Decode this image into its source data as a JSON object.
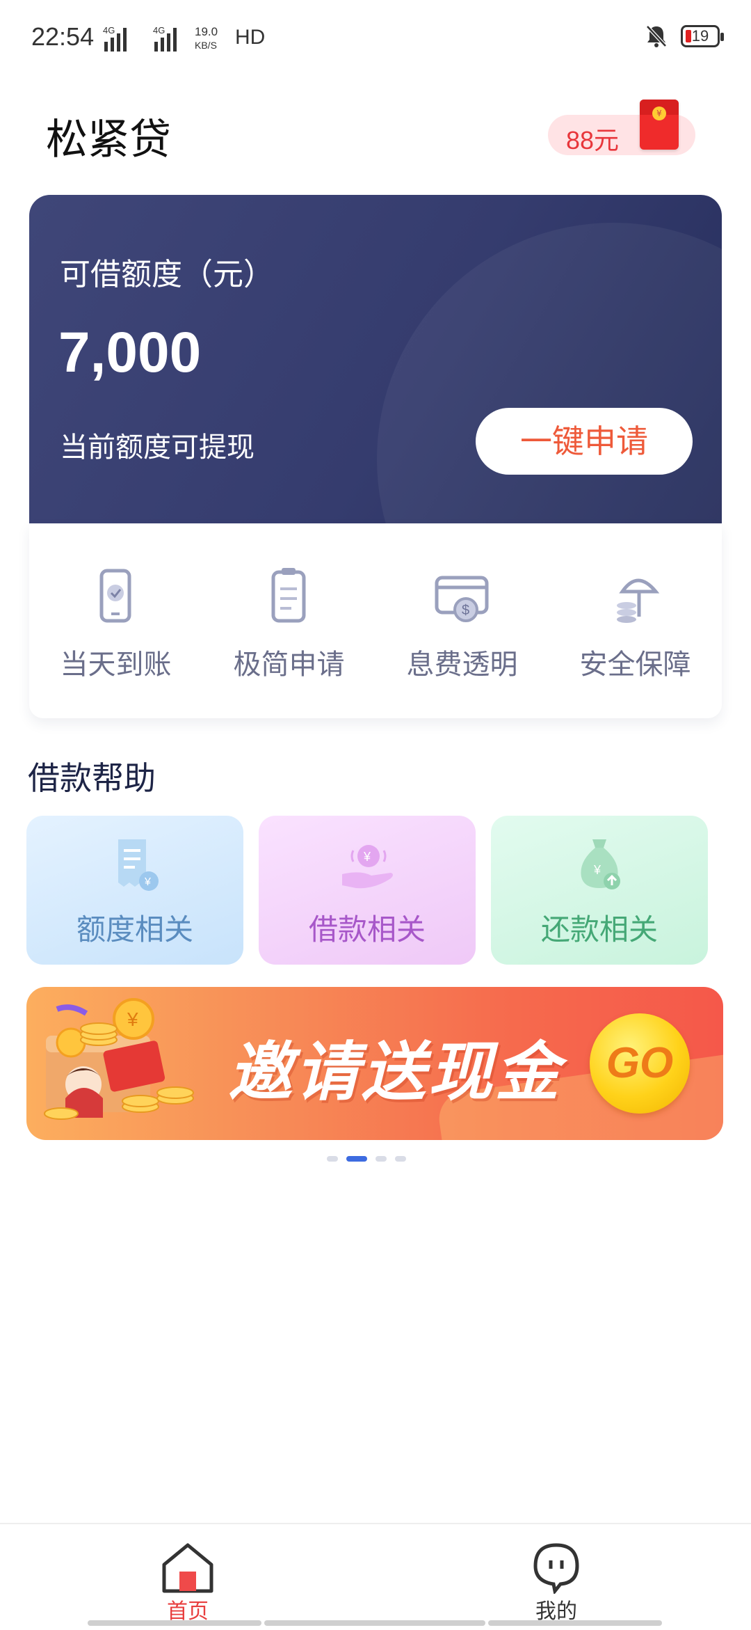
{
  "status_bar": {
    "time": "22:54",
    "network_1": "4G",
    "network_2": "4G",
    "speed": "19.0",
    "speed_unit": "KB/S",
    "hd": "HD",
    "battery": "19"
  },
  "header": {
    "title": "松紧贷",
    "red_packet": "88元"
  },
  "credit_card": {
    "label": "可借额度（元）",
    "amount": "7,000",
    "note": "当前额度可提现",
    "apply_button": "一键申请"
  },
  "features": [
    {
      "label": "当天到账",
      "icon": "phone-check-icon"
    },
    {
      "label": "极简申请",
      "icon": "document-icon"
    },
    {
      "label": "息费透明",
      "icon": "card-dollar-icon"
    },
    {
      "label": "安全保障",
      "icon": "umbrella-coins-icon"
    }
  ],
  "help": {
    "title": "借款帮助",
    "cards": [
      {
        "label": "额度相关",
        "icon": "receipt-yuan-icon"
      },
      {
        "label": "借款相关",
        "icon": "hand-coin-icon"
      },
      {
        "label": "还款相关",
        "icon": "money-bag-icon"
      }
    ]
  },
  "banner": {
    "text": "邀请送现金",
    "go": "GO"
  },
  "carousel": {
    "count": 4,
    "active": 2
  },
  "tab_bar": {
    "home": "首页",
    "mine": "我的"
  },
  "colors": {
    "card_bg": "#353c6e",
    "accent_red": "#e83e3e",
    "apply_text": "#ee5a3a",
    "dot_active": "#3d6be0"
  }
}
